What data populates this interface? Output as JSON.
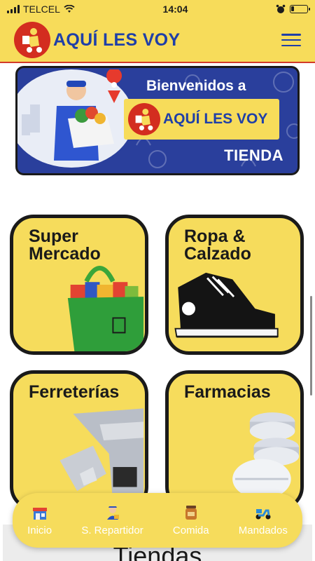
{
  "status_bar": {
    "carrier": "TELCEL",
    "time": "14:04"
  },
  "header": {
    "brand": "AQUÍ LES VOY",
    "menu_icon": "hamburger-menu-icon"
  },
  "banner": {
    "welcome": "Bienvenidos a",
    "brand": "AQUÍ LES VOY",
    "subtitle": "TIENDA"
  },
  "categories": [
    {
      "title_line1": "Super",
      "title_line2": "Mercado",
      "icon": "grocery-bag"
    },
    {
      "title_line1": "Ropa &",
      "title_line2": "Calzado",
      "icon": "sneaker"
    },
    {
      "title_line1": "Ferreterías",
      "title_line2": "",
      "icon": "wrench"
    },
    {
      "title_line1": "Farmacias",
      "title_line2": "",
      "icon": "pills"
    }
  ],
  "stores_section": {
    "title": "Tiendas"
  },
  "bottom_nav": [
    {
      "label": "Inicio",
      "icon": "store-icon"
    },
    {
      "label": "S. Repartidor",
      "icon": "delivery-person-icon"
    },
    {
      "label": "Comida",
      "icon": "food-jar-icon"
    },
    {
      "label": "Mandados",
      "icon": "scooter-icon"
    }
  ],
  "colors": {
    "yellow": "#f7dc5a",
    "blue": "#1f3fa8",
    "red": "#d32d1f",
    "banner_blue": "#2a3f9c"
  }
}
